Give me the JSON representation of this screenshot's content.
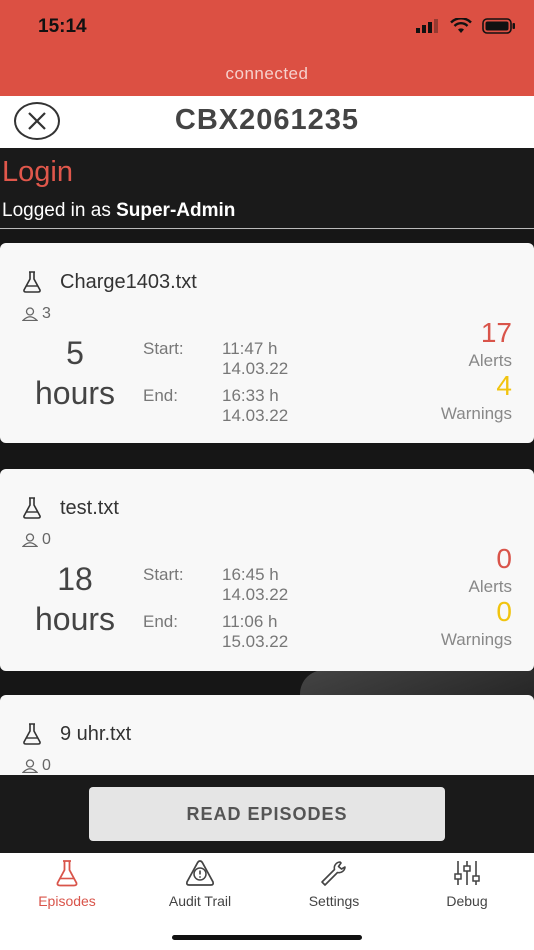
{
  "status": {
    "time": "15:14",
    "connection": "connected"
  },
  "header": {
    "device_id": "CBX2061235"
  },
  "login": {
    "title": "Login",
    "logged_prefix": "Logged in as ",
    "user": "Super-Admin"
  },
  "episodes": [
    {
      "name": "Charge1403.txt",
      "users": "3",
      "duration_value": "5",
      "duration_unit": "hours",
      "start_label": "Start:",
      "start_time": "11:47 h",
      "start_date": "14.03.22",
      "end_label": "End:",
      "end_time": "16:33 h",
      "end_date": "14.03.22",
      "alerts": "17",
      "alerts_label": "Alerts",
      "warnings": "4",
      "warnings_label": "Warnings"
    },
    {
      "name": "test.txt",
      "users": "0",
      "duration_value": "18",
      "duration_unit": "hours",
      "start_label": "Start:",
      "start_time": "16:45 h",
      "start_date": "14.03.22",
      "end_label": "End:",
      "end_time": "11:06 h",
      "end_date": "15.03.22",
      "alerts": "0",
      "alerts_label": "Alerts",
      "warnings": "0",
      "warnings_label": "Warnings"
    },
    {
      "name": "9 uhr.txt",
      "users": "0"
    }
  ],
  "actions": {
    "read_episodes": "READ EPISODES"
  },
  "tabs": [
    {
      "label": "Episodes",
      "icon": "flask-icon",
      "active": true
    },
    {
      "label": "Audit Trail",
      "icon": "warning-icon",
      "active": false
    },
    {
      "label": "Settings",
      "icon": "wrench-icon",
      "active": false
    },
    {
      "label": "Debug",
      "icon": "sliders-icon",
      "active": false
    }
  ],
  "colors": {
    "accent": "#dc5043",
    "alert": "#d9544a",
    "warning": "#f1c40f"
  }
}
